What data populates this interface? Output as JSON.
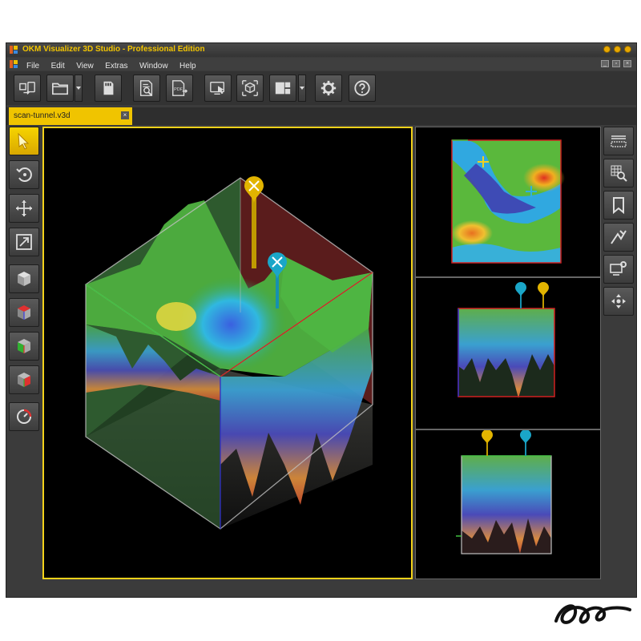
{
  "window": {
    "title": "OKM Visualizer 3D Studio - Professional Edition"
  },
  "menu": {
    "items": [
      "File",
      "Edit",
      "View",
      "Extras",
      "Window",
      "Help"
    ]
  },
  "toolbar": {
    "buttons": [
      {
        "name": "import-device-button",
        "icon": "device-transfer-icon"
      },
      {
        "name": "open-file-button",
        "icon": "folder-icon"
      },
      {
        "name": "save-file-button",
        "icon": "sd-card-icon"
      },
      {
        "name": "report-preview-button",
        "icon": "document-magnifier-icon"
      },
      {
        "name": "export-pdf-button",
        "icon": "pdf-export-icon"
      },
      {
        "name": "screenshot-button",
        "icon": "screen-capture-icon"
      },
      {
        "name": "3d-select-button",
        "icon": "cube-select-icon"
      },
      {
        "name": "layout-button",
        "icon": "layout-grid-icon"
      },
      {
        "name": "settings-button",
        "icon": "gear-icon"
      },
      {
        "name": "help-button",
        "icon": "question-icon"
      }
    ],
    "pdf_icon_text": "PDF"
  },
  "tabs": [
    {
      "label": "scan-tunnel.v3d",
      "active": true
    }
  ],
  "left_tools": [
    {
      "name": "tool-select",
      "icon": "pointer-icon",
      "active": true
    },
    {
      "name": "tool-rotate",
      "icon": "rotate-icon"
    },
    {
      "name": "tool-move",
      "icon": "move-arrows-icon"
    },
    {
      "name": "tool-zoom",
      "icon": "zoom-box-icon"
    },
    {
      "name": "view-3d",
      "icon": "cube-3d-icon"
    },
    {
      "name": "view-top",
      "icon": "cube-top-icon"
    },
    {
      "name": "view-side",
      "icon": "cube-side-icon"
    },
    {
      "name": "view-front",
      "icon": "cube-front-icon"
    },
    {
      "name": "reset-view",
      "icon": "reset-gauge-icon"
    }
  ],
  "right_tools": [
    {
      "name": "ground-layer-tool",
      "icon": "ground-layer-icon"
    },
    {
      "name": "grid-search-tool",
      "icon": "grid-magnifier-icon"
    },
    {
      "name": "bookmark-tool",
      "icon": "bookmark-icon"
    },
    {
      "name": "measure-tool",
      "icon": "measure-icon"
    },
    {
      "name": "monitor-settings-tool",
      "icon": "monitor-gear-icon"
    },
    {
      "name": "marker-move-tool",
      "icon": "crosshair-arrows-icon"
    }
  ],
  "colors": {
    "accent": "#f3d21b",
    "window_bg": "#3b3b3b",
    "view_bg": "#000000",
    "marker_yellow": "#e2b400",
    "marker_cyan": "#1aa6c8",
    "axis_red": "#d02020",
    "axis_blue": "#3030c8",
    "axis_green": "#40c040"
  }
}
